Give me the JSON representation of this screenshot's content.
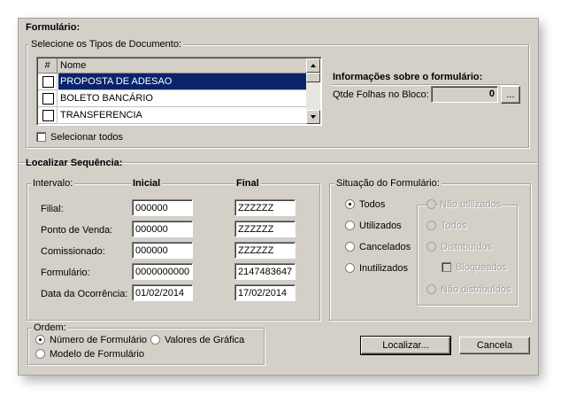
{
  "formulario": {
    "title": "Formulário:",
    "doc_types_group": "Selecione os Tipos de Documento:",
    "list_headers": [
      "#",
      "Nome"
    ],
    "list_items": [
      {
        "name": "PROPOSTA DE ADESAO",
        "selected": true,
        "checked": false
      },
      {
        "name": "BOLETO BANCÁRIO",
        "selected": false,
        "checked": false
      },
      {
        "name": "TRANSFERENCIA",
        "selected": false,
        "checked": false
      }
    ],
    "select_all_label": "Selecionar todos",
    "info_title": "Informações sobre o formulário:",
    "qtde_label": "Qtde Folhas no Bloco:",
    "qtde_value": "0",
    "ellipsis_label": "..."
  },
  "localizar": {
    "title": "Localizar Sequência:",
    "interval_group": "Intervalo:",
    "inicial_header": "Inicial",
    "final_header": "Final",
    "rows": [
      {
        "label": "Filial:",
        "inicial": "000000",
        "final": "ZZZZZZ"
      },
      {
        "label": "Ponto de Venda:",
        "inicial": "000000",
        "final": "ZZZZZZ"
      },
      {
        "label": "Comissionado:",
        "inicial": "000000",
        "final": "ZZZZZZ"
      },
      {
        "label": "Formulário:",
        "inicial": "0000000000",
        "final": "2147483647"
      },
      {
        "label": "Data da Ocorrência:",
        "inicial": "01/02/2014",
        "final": "17/02/2014"
      }
    ]
  },
  "situacao": {
    "title": "Situação do Formulário:",
    "options": [
      "Todos",
      "Utilizados",
      "Cancelados",
      "Inutilizados"
    ],
    "selected": "Todos",
    "nao_utilizados_label": "Não utilizados",
    "sub_options": [
      "Todos",
      "Distribuídos"
    ],
    "bloqueados_label": "Bloqueados",
    "nao_distribuidos_label": "Não distribuídos"
  },
  "ordem": {
    "title": "Ordem:",
    "options": [
      "Número de Formulário",
      "Valores de Gráfica",
      "Modelo de Formulário"
    ],
    "selected": "Número de Formulário"
  },
  "buttons": {
    "localizar": "Localizar...",
    "cancela": "Cancela"
  },
  "colors": {
    "window_bg": "#d4d0c8",
    "selection_bg": "#0a246a",
    "selection_text": "#ffffff",
    "disabled_text": "#a0a0a0"
  }
}
